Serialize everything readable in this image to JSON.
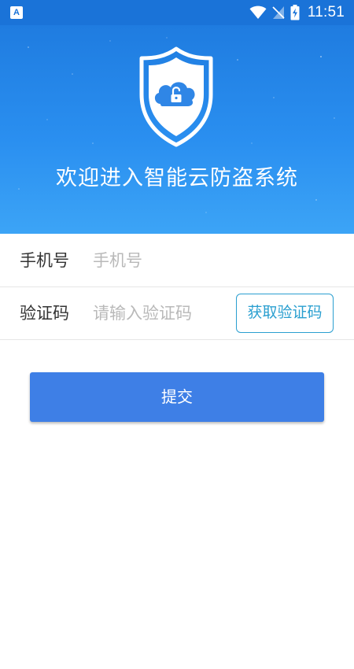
{
  "status_bar": {
    "app_icon_letter": "A",
    "time": "11:51",
    "icons": [
      "app-notification-icon",
      "wifi-icon",
      "no-signal-icon",
      "battery-charging-icon"
    ]
  },
  "header": {
    "title": "欢迎进入智能云防盗系统",
    "logo_icon": "shield-cloud-lock-icon"
  },
  "form": {
    "phone": {
      "label": "手机号",
      "placeholder": "手机号",
      "value": ""
    },
    "code": {
      "label": "验证码",
      "placeholder": "请输入验证码",
      "value": "",
      "get_code_label": "获取验证码"
    },
    "submit_label": "提交"
  },
  "colors": {
    "banner_top": "#1f7ce0",
    "banner_bottom": "#3ca4f6",
    "accent": "#2a9fd0",
    "submit": "#3e7fe6"
  }
}
